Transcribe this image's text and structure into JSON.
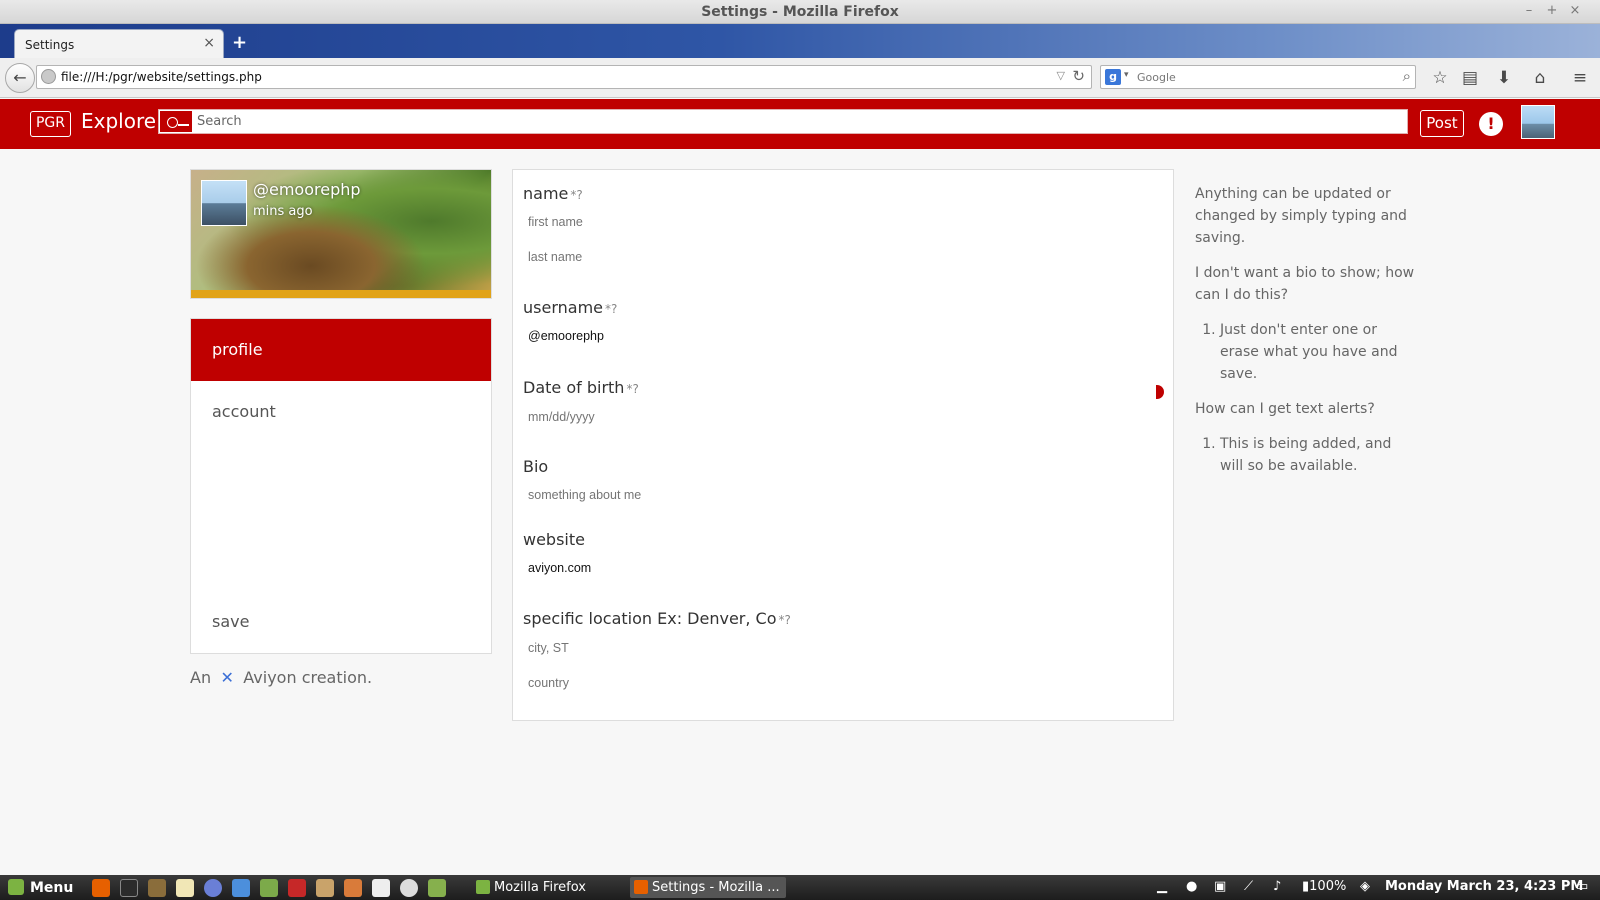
{
  "window": {
    "title": "Settings - Mozilla Firefox",
    "controls": [
      "–",
      "+",
      "×"
    ]
  },
  "browser": {
    "tab_title": "Settings",
    "tab_close": "×",
    "new_tab": "+",
    "back": "←",
    "url": "file:///H:/pgr/website/settings.php",
    "url_dropdown": "▽",
    "reload": "↻",
    "search_engine_letter": "g",
    "search_engine_dropdown": "▾",
    "search_placeholder": "Google",
    "search_go": "⌕",
    "toolbar_icons": [
      "star-icon",
      "reading-list-icon",
      "download-icon",
      "home-icon",
      "hamburger-menu-icon"
    ],
    "toolbar_glyphs": [
      "☆",
      "▤",
      "⬇",
      "⌂",
      "≡"
    ]
  },
  "site": {
    "logo": "PGR",
    "explore": "Explore",
    "search_placeholder": "Search",
    "post_label": "Post",
    "alert_glyph": "!",
    "brand_color": "#bf0000"
  },
  "profile_card": {
    "username": "@emoorephp",
    "time_ago": "mins ago"
  },
  "side_menu": {
    "items": [
      {
        "label": "profile",
        "active": true
      },
      {
        "label": "account",
        "active": false
      }
    ],
    "save_label": "save"
  },
  "footer": {
    "prefix": "An",
    "brand": "Aviyon creation."
  },
  "form": {
    "required_marker": "*?",
    "name": {
      "label": "name",
      "first_placeholder": "first name",
      "last_placeholder": "last name"
    },
    "username": {
      "label": "username",
      "value": "@emoorephp"
    },
    "dob": {
      "label": "Date of birth",
      "placeholder": "mm/dd/yyyy"
    },
    "bio": {
      "label": "Bio",
      "placeholder": "something about me"
    },
    "website": {
      "label": "website",
      "value": "aviyon.com"
    },
    "location": {
      "label": "specific location Ex: Denver, Co",
      "city_placeholder": "city, ST",
      "country_placeholder": "country"
    }
  },
  "help": {
    "intro": "Anything can be updated or changed by simply typing and saving.",
    "q1": "I don't want a bio to show; how can I do this?",
    "a1": "Just don't enter one or erase what you have and save.",
    "q2": "How can I get text alerts?",
    "a2": "This is being added, and will so be available."
  },
  "taskbar": {
    "menu_label": "Menu",
    "windows": [
      {
        "label": "Mozilla Firefox",
        "active": false
      },
      {
        "label": "Settings - Mozilla ...",
        "active": true
      }
    ],
    "battery": "100%",
    "clock": "Monday March 23,  4:23 PM"
  }
}
